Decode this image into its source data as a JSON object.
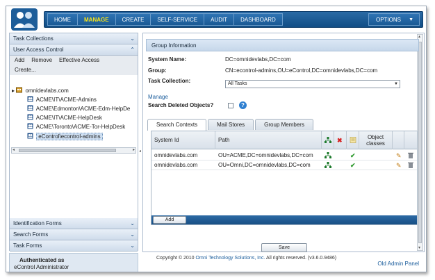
{
  "nav": {
    "items": [
      "HOME",
      "MANAGE",
      "CREATE",
      "SELF-SERVICE",
      "AUDIT",
      "DASHBOARD"
    ],
    "active": "MANAGE",
    "options_label": "OPTIONS"
  },
  "sidebar": {
    "task_collections": "Task Collections",
    "user_access_control": "User Access Control",
    "actions": {
      "add": "Add",
      "remove": "Remove",
      "effective_access": "Effective Access",
      "create": "Create..."
    },
    "tree": {
      "root": "omnidevlabs.com",
      "items": [
        "ACME\\IT\\ACME-Admins",
        "ACME\\Edmonton\\ACME-Edm-HelpDe",
        "ACME\\IT\\ACME-HelpDesk",
        "ACME\\Toronto\\ACME-Tor-HelpDesk",
        "eControl\\econtrol-admins"
      ],
      "selected_index": 4
    },
    "bottom": [
      "Identification Forms",
      "Search Forms",
      "Task Forms"
    ]
  },
  "main": {
    "group_info_title": "Group Information",
    "system_name_label": "System Name:",
    "system_name_value": "DC=omnidevlabs,DC=com",
    "group_label": "Group:",
    "group_value": "CN=econtrol-admins,OU=eControl,DC=omnidevlabs,DC=com",
    "task_collection_label": "Task Collection:",
    "task_collection_value": "All Tasks",
    "manage_link": "Manage",
    "search_deleted_label": "Search Deleted Objects?",
    "help_icon": "?",
    "tabs": [
      "Search Contexts",
      "Mail Stores",
      "Group Members"
    ],
    "active_tab": 0,
    "grid": {
      "headers": {
        "system_id": "System Id",
        "path": "Path",
        "object_classes_1": "Object",
        "object_classes_2": "classes"
      },
      "rows": [
        {
          "system_id": "omnidevlabs.com",
          "path": "OU=ACME,DC=omnidevlabs,DC=com"
        },
        {
          "system_id": "omnidevlabs.com",
          "path": "OU=Omni,DC=omnidevlabs,DC=com"
        }
      ],
      "add_label": "Add"
    },
    "save_label": "Save"
  },
  "footer": {
    "auth_line1": "Authenticated as",
    "auth_line2": "eControl Administrator",
    "copyright_pre": "Copyright © 2010 ",
    "copyright_link": "Omni Technology Solutions, Inc.",
    "copyright_post": " All rights reserved. (v3.6.0.9486)",
    "old_admin": "Old Admin Panel"
  },
  "colors": {
    "nav_blue": "#1a5a95",
    "active_nav": "#f4e21b",
    "link": "#1b5d9c"
  }
}
